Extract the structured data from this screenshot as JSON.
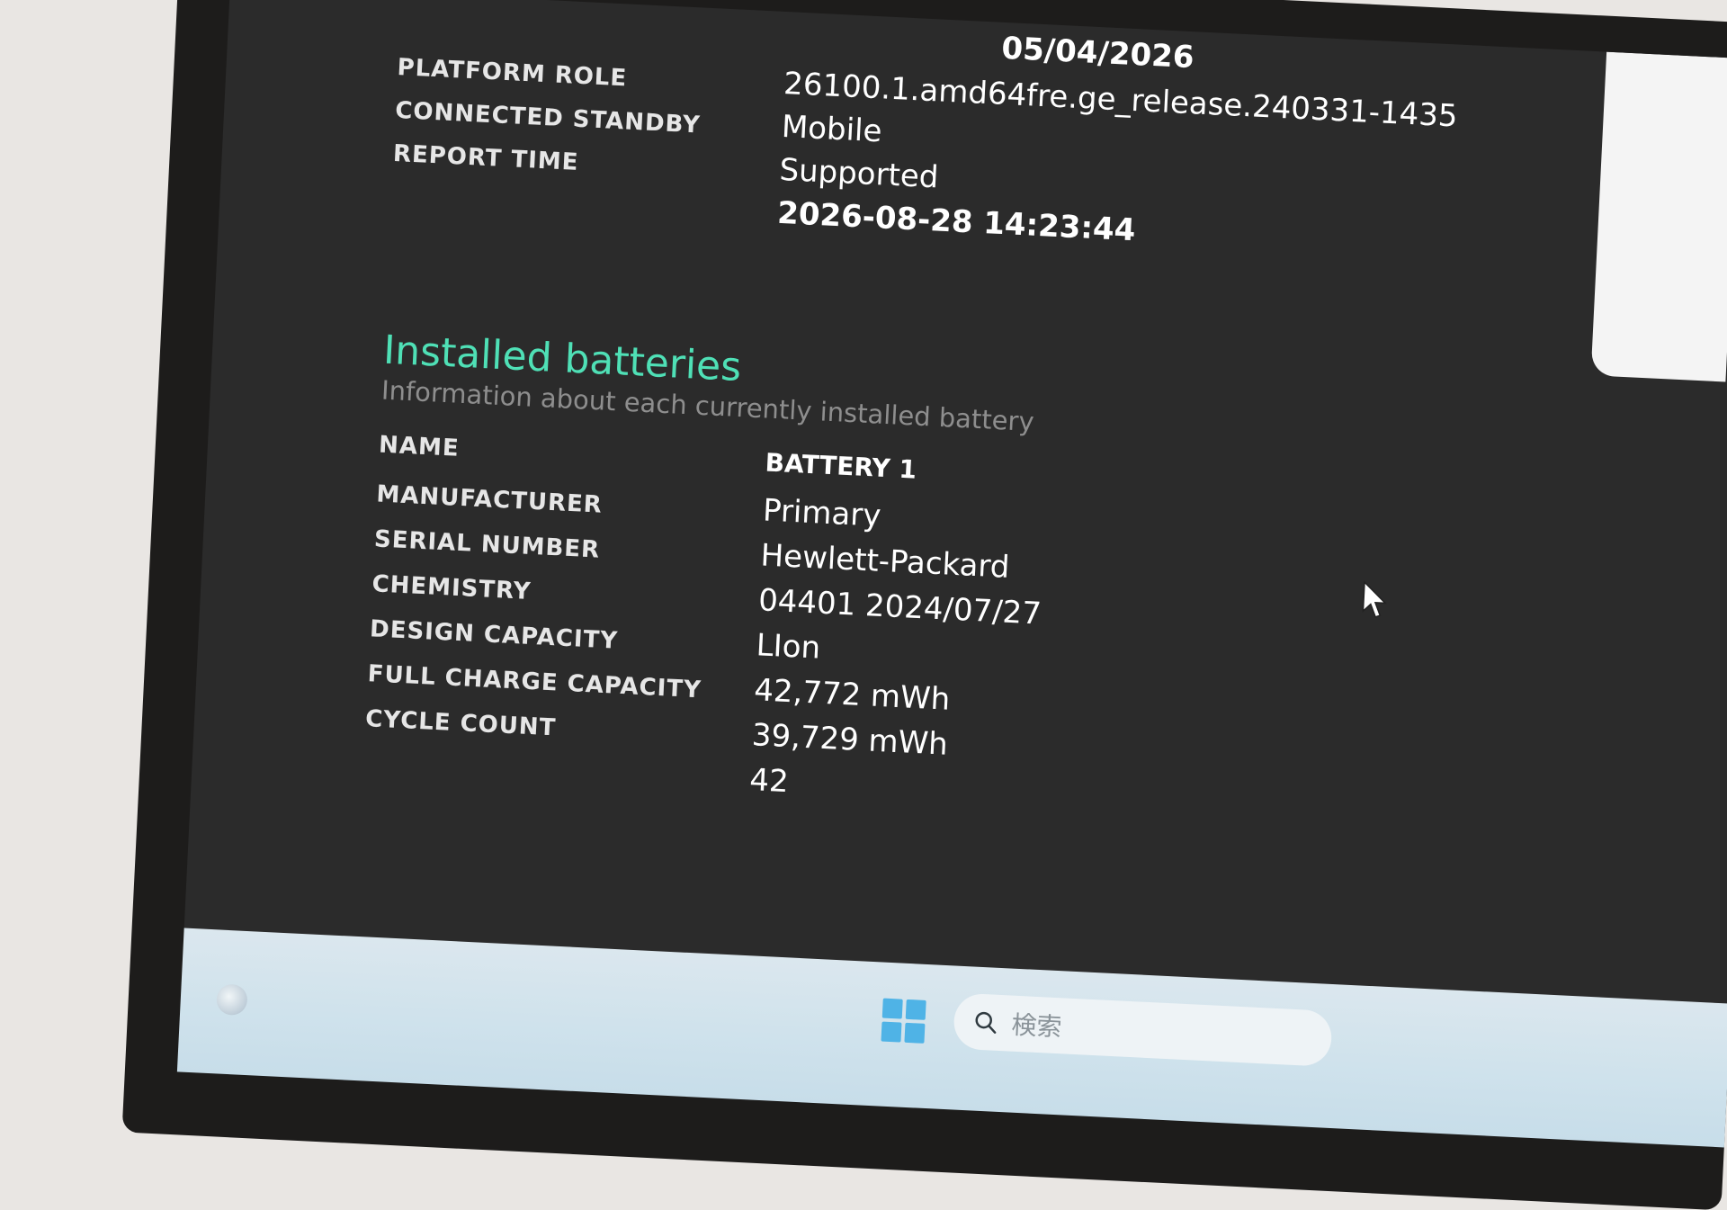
{
  "system_info": {
    "date_fragment": "05/04/2026",
    "rows": [
      {
        "label": "PLATFORM ROLE",
        "value": "26100.1.amd64fre.ge_release.240331-1435"
      },
      {
        "label": "CONNECTED STANDBY",
        "value": "Mobile"
      },
      {
        "label": "REPORT TIME",
        "value": "Supported"
      },
      {
        "label": "",
        "value": "2026-08-28  14:23:44"
      }
    ]
  },
  "batteries": {
    "title": "Installed batteries",
    "subtitle": "Information about each currently installed battery",
    "rows": [
      {
        "label": "NAME",
        "value": "BATTERY 1"
      },
      {
        "label": "MANUFACTURER",
        "value": "Primary"
      },
      {
        "label": "SERIAL NUMBER",
        "value": "Hewlett-Packard"
      },
      {
        "label": "CHEMISTRY",
        "value": "04401 2024/07/27"
      },
      {
        "label": "DESIGN CAPACITY",
        "value": "LIon"
      },
      {
        "label": "FULL CHARGE CAPACITY",
        "value": "42,772 mWh"
      },
      {
        "label": "CYCLE COUNT",
        "value": "39,729 mWh"
      },
      {
        "label": "",
        "value": "42"
      }
    ]
  },
  "taskbar": {
    "search_placeholder": "検索",
    "accent_color": "#4fe0b6"
  },
  "icons": [
    "start-orb-icon",
    "windows-logo-icon",
    "search-icon",
    "mouse-cursor-icon"
  ]
}
